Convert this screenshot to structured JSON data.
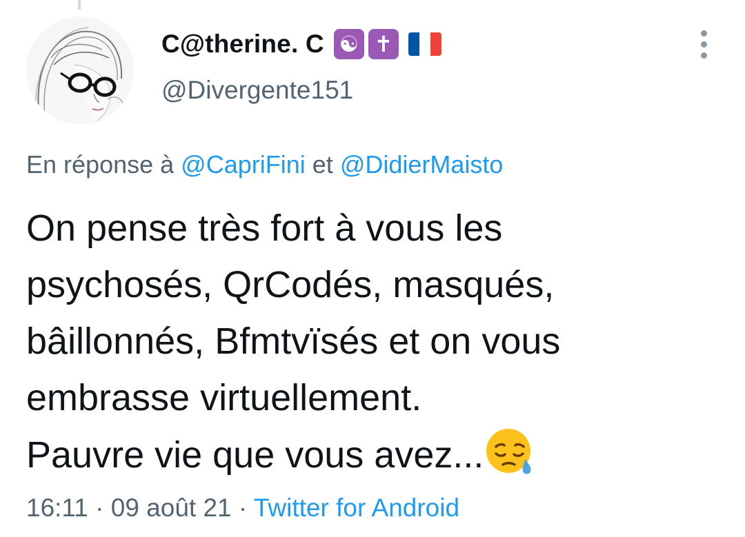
{
  "author": {
    "display_name": "C@therine. C",
    "handle": "@Divergente151",
    "badges": [
      {
        "icon": "yin-yang-icon",
        "glyph": "☯",
        "color": "#9b59b6"
      },
      {
        "icon": "latin-cross-icon",
        "glyph": "✝",
        "color": "#9b59b6"
      }
    ],
    "flag": {
      "icon": "france-flag-icon",
      "colors": [
        "#0055a4",
        "#ffffff",
        "#ef4135"
      ]
    },
    "avatar": {
      "icon": "woman-with-glasses-sketch-avatar"
    }
  },
  "reply": {
    "prefix": "En réponse à",
    "mentions": [
      "@CapriFini",
      "@DidierMaisto"
    ],
    "separator": "et"
  },
  "tweet": {
    "lines": [
      "On pense très fort à vous les",
      "psychosés, QrCodés, masqués,",
      "bâillonnés, Bfmtvïsés  et on vous",
      "embrasse virtuellement.",
      "Pauvre vie que vous avez..."
    ],
    "emoji": "sad-relieved-face-with-sweat-icon"
  },
  "meta": {
    "time": "16:11",
    "dot1": "·",
    "date": "09 août 21",
    "dot2": "·",
    "source": "Twitter for Android"
  },
  "colors": {
    "text": "#0f1419",
    "secondary": "#536471",
    "link": "#1d9bf0",
    "badge": "#9b59b6"
  }
}
